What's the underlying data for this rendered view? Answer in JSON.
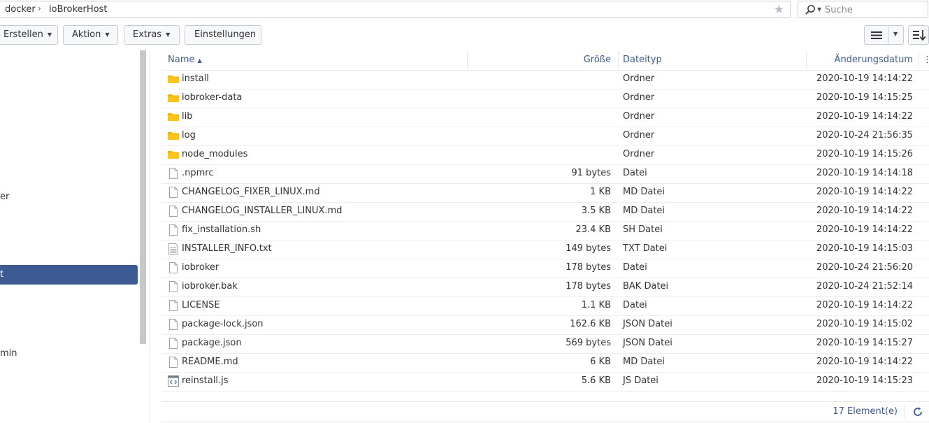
{
  "breadcrumb": {
    "segments": [
      "docker",
      "ioBrokerHost"
    ],
    "separator": "›"
  },
  "search": {
    "placeholder": "Suche"
  },
  "toolbar": {
    "create_label": "Erstellen",
    "action_label": "Aktion",
    "extras_label": "Extras",
    "settings_label": "Einstellungen"
  },
  "sidebar": {
    "partial_labels": [
      "er",
      "t",
      "min"
    ],
    "active_label": "t"
  },
  "columns": {
    "name": "Name",
    "size": "Größe",
    "type": "Dateityp",
    "date": "Änderungsdatum"
  },
  "files": [
    {
      "name": "install",
      "size": "",
      "type": "Ordner",
      "date": "2020-10-19 14:14:22",
      "icon": "folder-icon"
    },
    {
      "name": "iobroker-data",
      "size": "",
      "type": "Ordner",
      "date": "2020-10-19 14:15:25",
      "icon": "folder-icon"
    },
    {
      "name": "lib",
      "size": "",
      "type": "Ordner",
      "date": "2020-10-19 14:14:22",
      "icon": "folder-icon"
    },
    {
      "name": "log",
      "size": "",
      "type": "Ordner",
      "date": "2020-10-24 21:56:35",
      "icon": "folder-icon"
    },
    {
      "name": "node_modules",
      "size": "",
      "type": "Ordner",
      "date": "2020-10-19 14:15:26",
      "icon": "folder-icon"
    },
    {
      "name": ".npmrc",
      "size": "91 bytes",
      "type": "Datei",
      "date": "2020-10-19 14:14:18",
      "icon": "file-icon"
    },
    {
      "name": "CHANGELOG_FIXER_LINUX.md",
      "size": "1 KB",
      "type": "MD Datei",
      "date": "2020-10-19 14:14:22",
      "icon": "file-icon"
    },
    {
      "name": "CHANGELOG_INSTALLER_LINUX.md",
      "size": "3.5 KB",
      "type": "MD Datei",
      "date": "2020-10-19 14:14:22",
      "icon": "file-icon"
    },
    {
      "name": "fix_installation.sh",
      "size": "23.4 KB",
      "type": "SH Datei",
      "date": "2020-10-19 14:14:22",
      "icon": "file-icon"
    },
    {
      "name": "INSTALLER_INFO.txt",
      "size": "149 bytes",
      "type": "TXT Datei",
      "date": "2020-10-19 14:15:03",
      "icon": "text-file-icon"
    },
    {
      "name": "iobroker",
      "size": "178 bytes",
      "type": "Datei",
      "date": "2020-10-24 21:56:20",
      "icon": "file-icon"
    },
    {
      "name": "iobroker.bak",
      "size": "178 bytes",
      "type": "BAK Datei",
      "date": "2020-10-24 21:52:14",
      "icon": "file-icon"
    },
    {
      "name": "LICENSE",
      "size": "1.1 KB",
      "type": "Datei",
      "date": "2020-10-19 14:14:22",
      "icon": "file-icon"
    },
    {
      "name": "package-lock.json",
      "size": "162.6 KB",
      "type": "JSON Datei",
      "date": "2020-10-19 14:15:02",
      "icon": "file-icon"
    },
    {
      "name": "package.json",
      "size": "569 bytes",
      "type": "JSON Datei",
      "date": "2020-10-19 14:15:27",
      "icon": "file-icon"
    },
    {
      "name": "README.md",
      "size": "6 KB",
      "type": "MD Datei",
      "date": "2020-10-19 14:14:22",
      "icon": "file-icon"
    },
    {
      "name": "reinstall.js",
      "size": "5.6 KB",
      "type": "JS Datei",
      "date": "2020-10-19 14:15:23",
      "icon": "code-file-icon"
    }
  ],
  "footer": {
    "count_label": "17 Element(e)"
  },
  "colors": {
    "accent": "#3d5a93",
    "folder": "#f5b400",
    "border": "#c9ced6"
  }
}
